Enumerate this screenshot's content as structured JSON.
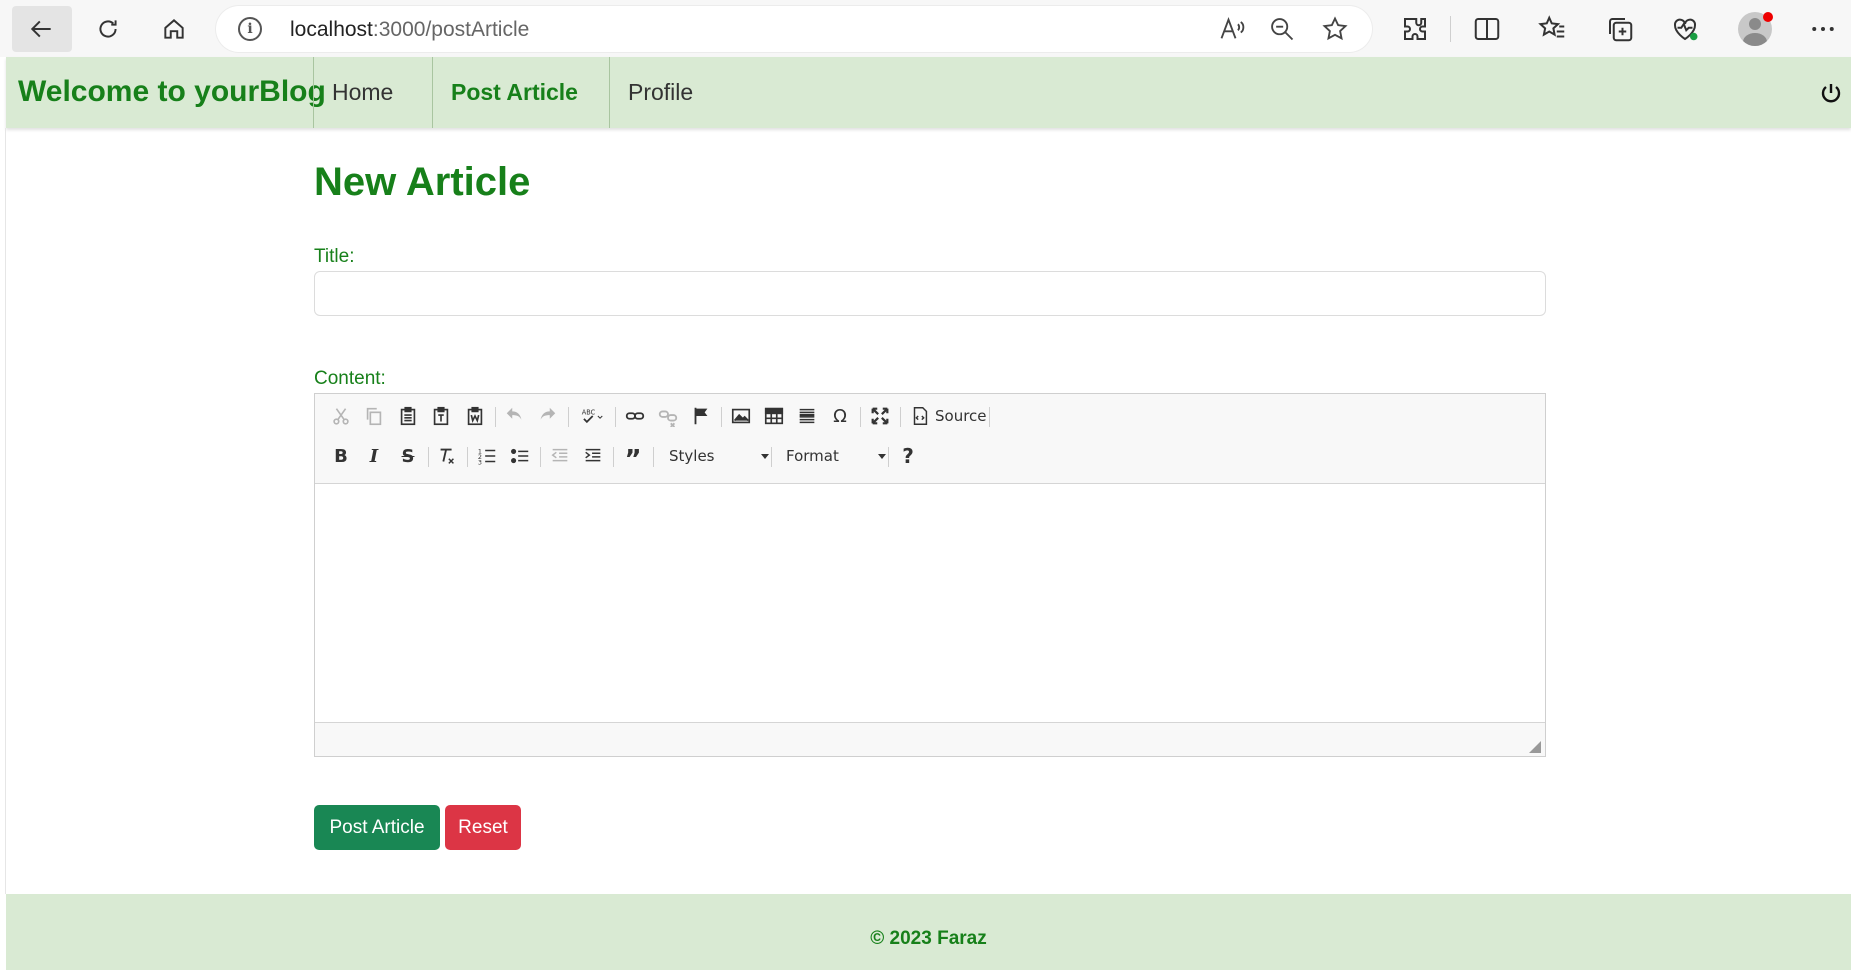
{
  "browser": {
    "url_host": "localhost",
    "url_path": ":3000/postArticle"
  },
  "navbar": {
    "brand": "Welcome to yourBlog",
    "links": [
      "Home",
      "Post Article",
      "Profile"
    ]
  },
  "form": {
    "heading": "New Article",
    "title_label": "Title:",
    "title_value": "",
    "content_label": "Content:",
    "editor": {
      "source_label": "Source",
      "styles_label": "Styles",
      "format_label": "Format",
      "help_label": "?"
    },
    "submit_label": "Post Article",
    "reset_label": "Reset"
  },
  "footer": {
    "text": "© 2023 Faraz"
  }
}
